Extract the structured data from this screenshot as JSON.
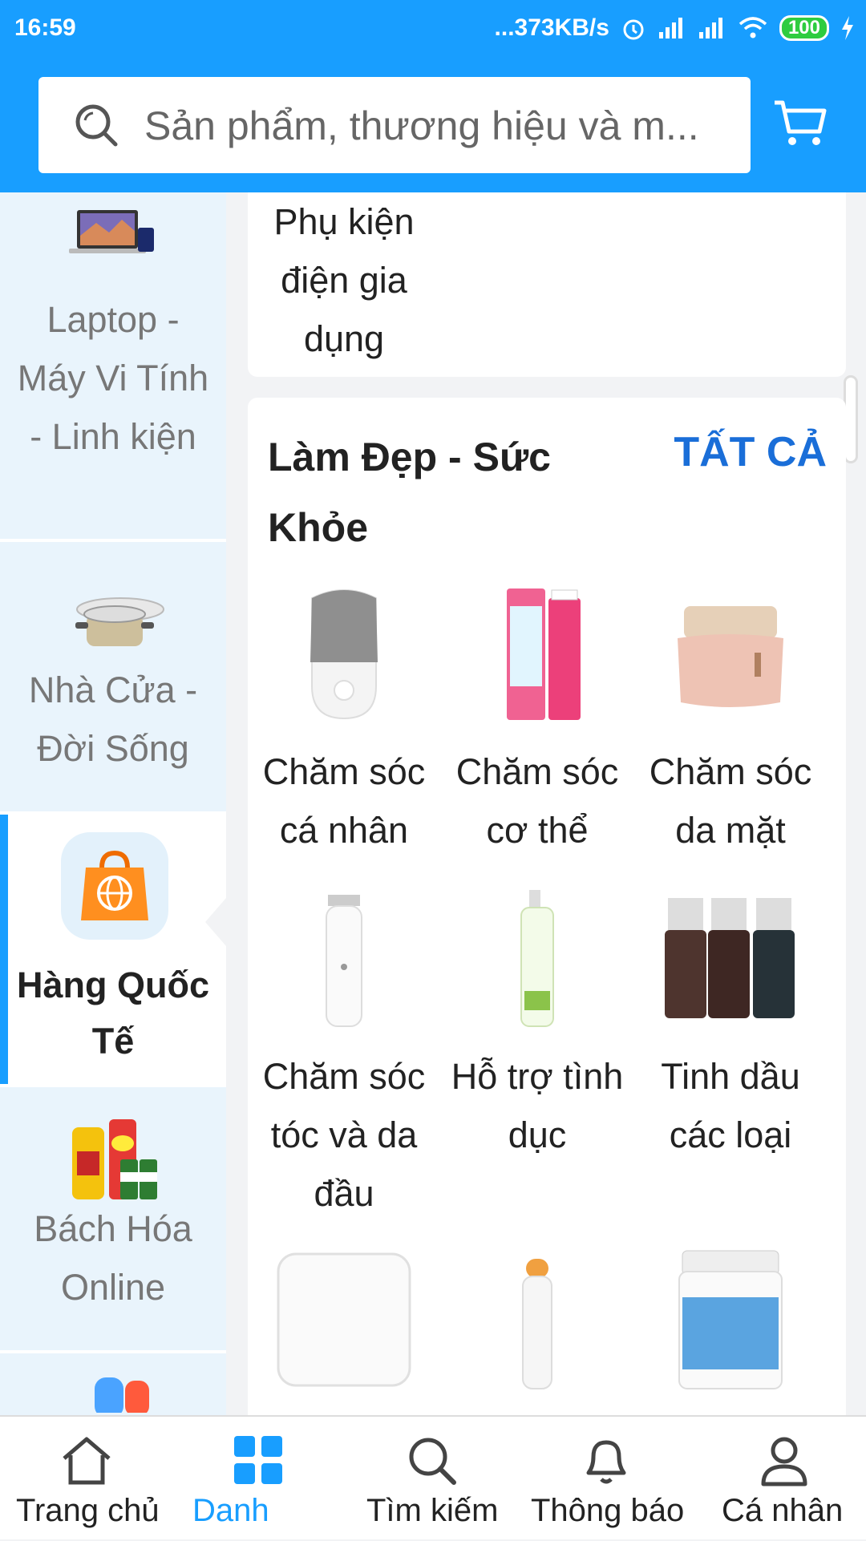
{
  "status_bar": {
    "time": "16:59",
    "network_speed": "...373KB/s",
    "battery": "100"
  },
  "search": {
    "placeholder": "Sản phẩm, thương hiệu và m..."
  },
  "sidebar": {
    "items": [
      {
        "label": "Laptop - Máy Vi Tính - Linh kiện",
        "icon": "laptop-icon"
      },
      {
        "label": "Nhà Cửa - Đời Sống",
        "icon": "cookware-icon"
      },
      {
        "label": "Hàng Quốc Tế",
        "icon": "global-shopping-bag-icon",
        "active": true
      },
      {
        "label": "Bách Hóa Online",
        "icon": "grocery-icon"
      }
    ]
  },
  "prev_section": {
    "item_label": "Phụ kiện điện gia dụng"
  },
  "section": {
    "title": "Làm Đẹp - Sức Khỏe",
    "see_all": "TẤT CẢ",
    "items": [
      {
        "label": "Chăm sóc cá nhân",
        "icon": "face-cleanser-icon"
      },
      {
        "label": "Chăm sóc cơ thể",
        "icon": "hair-removal-cream-icon"
      },
      {
        "label": "Chăm sóc da mặt",
        "icon": "face-cream-jar-icon"
      },
      {
        "label": "Chăm sóc tóc và da đầu",
        "icon": "hair-clipper-icon"
      },
      {
        "label": "Hỗ trợ tình dục",
        "icon": "lotion-bottle-icon"
      },
      {
        "label": "Tinh dầu các loại",
        "icon": "essential-oil-bottles-icon"
      },
      {
        "label": "",
        "icon": "smart-scale-icon"
      },
      {
        "label": "",
        "icon": "eye-massager-icon"
      },
      {
        "label": "",
        "icon": "fish-oil-jar-icon"
      }
    ]
  },
  "bottom_nav": {
    "items": [
      {
        "label": "Trang chủ",
        "icon": "home-icon"
      },
      {
        "label": "Danh",
        "icon": "category-grid-icon",
        "active": true
      },
      {
        "label": "Tìm kiếm",
        "icon": "search-icon"
      },
      {
        "label": "Thông báo",
        "icon": "bell-icon"
      },
      {
        "label": "Cá nhân",
        "icon": "user-icon"
      }
    ]
  },
  "colors": {
    "primary": "#189eff",
    "see_all": "#1a6ed8",
    "sidebar_bg": "#e9f4fc"
  }
}
